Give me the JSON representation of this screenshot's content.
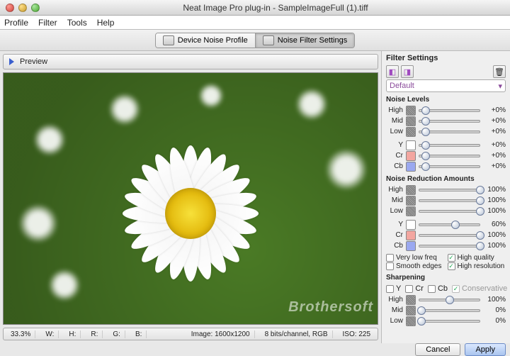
{
  "window": {
    "title": "Neat Image Pro plug-in - SampleImageFull (1).tiff"
  },
  "menu": {
    "items": [
      "Profile",
      "Filter",
      "Tools",
      "Help"
    ]
  },
  "toolbar": {
    "tabs": [
      {
        "label": "Device Noise Profile",
        "active": false
      },
      {
        "label": "Noise Filter Settings",
        "active": true
      }
    ]
  },
  "preview": {
    "label": "Preview"
  },
  "status": {
    "zoom": "33.3%",
    "w": "W:",
    "h": "H:",
    "r": "R:",
    "g": "G:",
    "b": "B:",
    "image": "Image: 1600x1200",
    "bits": "8 bits/channel, RGB",
    "iso": "ISO: 225"
  },
  "panel": {
    "title": "Filter Settings",
    "preset": "Default",
    "noise_levels": {
      "title": "Noise Levels",
      "rows": [
        {
          "lbl": "High",
          "sw": "noise",
          "pos": 12,
          "val": "+0%"
        },
        {
          "lbl": "Mid",
          "sw": "noise",
          "pos": 12,
          "val": "+0%"
        },
        {
          "lbl": "Low",
          "sw": "noise",
          "pos": 12,
          "val": "+0%"
        },
        {
          "lbl": "Y",
          "sw": "y",
          "pos": 12,
          "val": "+0%"
        },
        {
          "lbl": "Cr",
          "sw": "cr",
          "pos": 12,
          "val": "+0%"
        },
        {
          "lbl": "Cb",
          "sw": "cb",
          "pos": 12,
          "val": "+0%"
        }
      ]
    },
    "reduction": {
      "title": "Noise Reduction Amounts",
      "rows": [
        {
          "lbl": "High",
          "sw": "noise",
          "pos": 100,
          "val": "100%"
        },
        {
          "lbl": "Mid",
          "sw": "noise",
          "pos": 100,
          "val": "100%"
        },
        {
          "lbl": "Low",
          "sw": "noise",
          "pos": 100,
          "val": "100%"
        },
        {
          "lbl": "Y",
          "sw": "y",
          "pos": 60,
          "val": "60%"
        },
        {
          "lbl": "Cr",
          "sw": "cr",
          "pos": 100,
          "val": "100%"
        },
        {
          "lbl": "Cb",
          "sw": "cb",
          "pos": 100,
          "val": "100%"
        }
      ]
    },
    "checks": {
      "very_low": {
        "label": "Very low freq",
        "checked": false
      },
      "smooth": {
        "label": "Smooth edges",
        "checked": false
      },
      "hq": {
        "label": "High quality",
        "checked": true
      },
      "hr": {
        "label": "High resolution",
        "checked": true
      }
    },
    "sharpening": {
      "title": "Sharpening",
      "channels": {
        "y": "Y",
        "cr": "Cr",
        "cb": "Cb",
        "cons": "Conservative"
      },
      "rows": [
        {
          "lbl": "High",
          "sw": "noise",
          "pos": 50,
          "val": "100%"
        },
        {
          "lbl": "Mid",
          "sw": "noise",
          "pos": 5,
          "val": "0%"
        },
        {
          "lbl": "Low",
          "sw": "noise",
          "pos": 5,
          "val": "0%"
        }
      ]
    }
  },
  "footer": {
    "cancel": "Cancel",
    "apply": "Apply"
  },
  "watermark": "Brothersoft"
}
